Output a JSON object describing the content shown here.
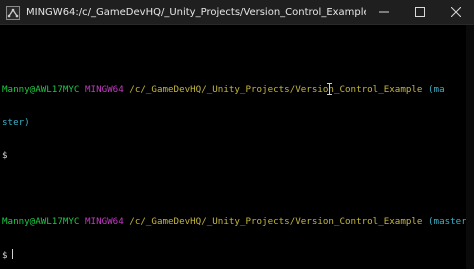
{
  "window": {
    "title": "MINGW64:/c/_GameDevHQ/_Unity_Projects/Version_Control_Example",
    "controls": {
      "minimize": "—",
      "maximize": "☐",
      "close": "✕"
    }
  },
  "icons": {
    "app": "git-bash-icon",
    "text_cursor": "ibeam-cursor-icon"
  },
  "terminal": {
    "prompt1": {
      "user_host": "Manny@AWL17MYC",
      "env": "MINGW64",
      "path": "/c/_GameDevHQ/_Unity_Projects/Version_Control_Example",
      "branch_part1": "(ma",
      "branch_part2": "ster)"
    },
    "line1_input": "$",
    "prompt2": {
      "user_host": "Manny@AWL17MYC",
      "env": "MINGW64",
      "path": "/c/_GameDevHQ/_Unity_Projects/Version_Control_Example",
      "branch": "(master)"
    },
    "line2_input": "$"
  },
  "colors": {
    "user_host": "#1ec744",
    "env": "#c13ac1",
    "path": "#c4b63d",
    "branch": "#39b1c6",
    "text": "#d0d0d0",
    "background": "#000000",
    "titlebar": "#1f1f1f"
  }
}
